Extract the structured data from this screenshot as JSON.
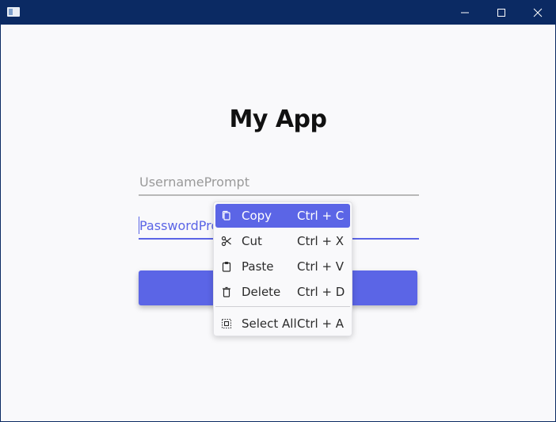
{
  "window": {
    "controls": {
      "minimize_icon": "minimize-icon",
      "maximize_icon": "maximize-icon",
      "close_icon": "close-icon"
    }
  },
  "app": {
    "title": "My App",
    "username_placeholder": "UsernamePrompt",
    "password_placeholder": "PasswordPrompt",
    "login_button_label": ""
  },
  "context_menu": {
    "items": [
      {
        "label": "Copy",
        "shortcut": "Ctrl + C",
        "icon": "copy-icon",
        "active": true
      },
      {
        "label": "Cut",
        "shortcut": "Ctrl + X",
        "icon": "scissors-icon"
      },
      {
        "label": "Paste",
        "shortcut": "Ctrl + V",
        "icon": "clipboard-icon"
      },
      {
        "label": "Delete",
        "shortcut": "Ctrl + D",
        "icon": "trash-icon"
      },
      {
        "label": "Select All",
        "shortcut": "Ctrl + A",
        "icon": "select-all-icon"
      }
    ]
  },
  "colors": {
    "accent": "#5b65e6",
    "titlebar": "#0b2a63",
    "background": "#f9f9fb"
  }
}
